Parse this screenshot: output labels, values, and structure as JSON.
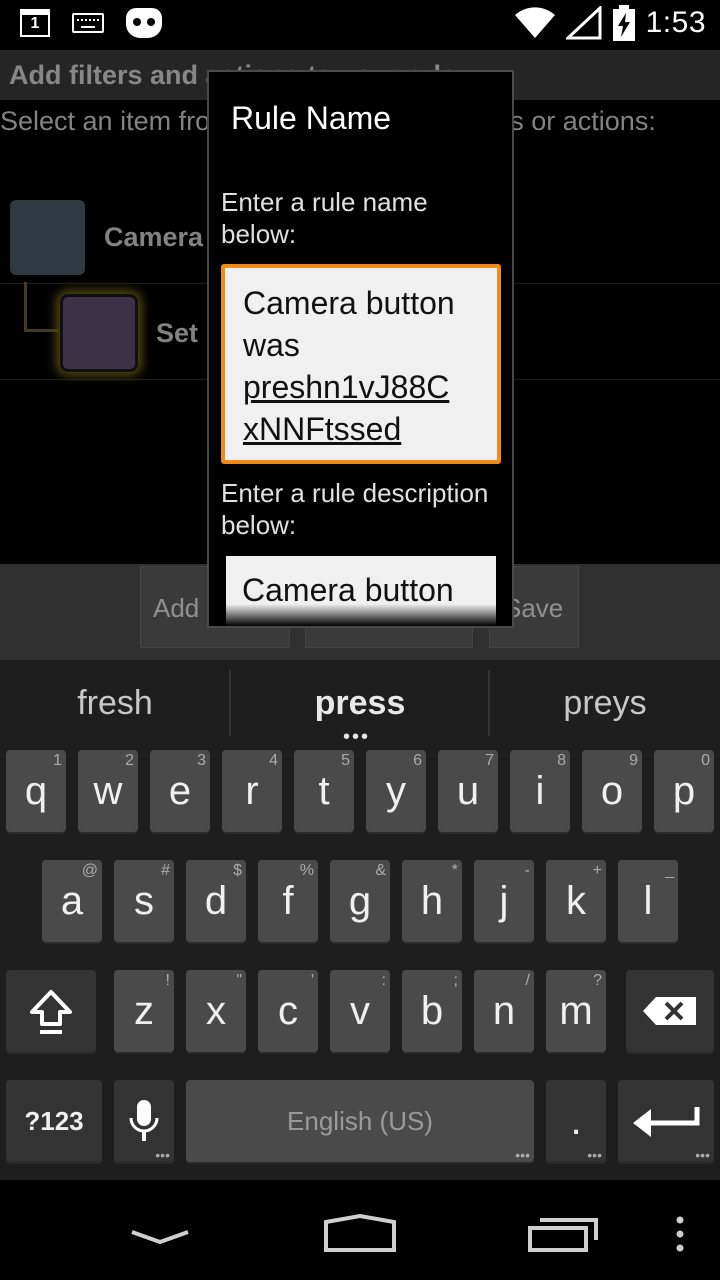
{
  "status_bar": {
    "calendar_day": "1",
    "time": "1:53",
    "icons": [
      "calendar-icon",
      "keyboard-icon",
      "cyanogenmod-icon",
      "wifi-icon",
      "signal-icon",
      "battery-charging-icon"
    ]
  },
  "app": {
    "header": "Add filters and actions to your rule",
    "instruction": "Select an item from the tree, then add filters or actions:",
    "rows": [
      {
        "label": "Camera button was pressed",
        "color": "#4c5a66"
      },
      {
        "label": "Set F",
        "color": "#5d4e6d"
      }
    ],
    "buttons": {
      "add_filter": "Add Fi",
      "add_action": "",
      "save": "Save"
    }
  },
  "dialog": {
    "title": "Rule Name",
    "name_label": "Enter a rule name below:",
    "name_value_line1": "Camera button",
    "name_value_line2": "was",
    "name_value_line3": "preshn1vJ88C",
    "name_value_line4": "xNNFtssed",
    "desc_label": "Enter a rule description below:",
    "desc_value": "Camera button",
    "accent_color": "#f08a18"
  },
  "keyboard": {
    "suggestions": [
      "fresh",
      "press",
      "preys"
    ],
    "row1": [
      {
        "k": "q",
        "h": "1"
      },
      {
        "k": "w",
        "h": "2"
      },
      {
        "k": "e",
        "h": "3"
      },
      {
        "k": "r",
        "h": "4"
      },
      {
        "k": "t",
        "h": "5"
      },
      {
        "k": "y",
        "h": "6"
      },
      {
        "k": "u",
        "h": "7"
      },
      {
        "k": "i",
        "h": "8"
      },
      {
        "k": "o",
        "h": "9"
      },
      {
        "k": "p",
        "h": "0"
      }
    ],
    "row2": [
      {
        "k": "a",
        "h": "@"
      },
      {
        "k": "s",
        "h": "#"
      },
      {
        "k": "d",
        "h": "$"
      },
      {
        "k": "f",
        "h": "%"
      },
      {
        "k": "g",
        "h": "&"
      },
      {
        "k": "h",
        "h": "*"
      },
      {
        "k": "j",
        "h": "-"
      },
      {
        "k": "k",
        "h": "+"
      },
      {
        "k": "l",
        "h": "_"
      }
    ],
    "row3": [
      {
        "k": "z",
        "h": "!"
      },
      {
        "k": "x",
        "h": "\""
      },
      {
        "k": "c",
        "h": "'"
      },
      {
        "k": "v",
        "h": ":"
      },
      {
        "k": "b",
        "h": ";"
      },
      {
        "k": "n",
        "h": "/"
      },
      {
        "k": "m",
        "h": "?"
      }
    ],
    "symbols_key": "?123",
    "space_label": "English (US)",
    "period_key": "."
  },
  "nav_bar": {
    "icons": [
      "back-icon",
      "home-icon",
      "recents-icon",
      "menu-icon"
    ]
  }
}
